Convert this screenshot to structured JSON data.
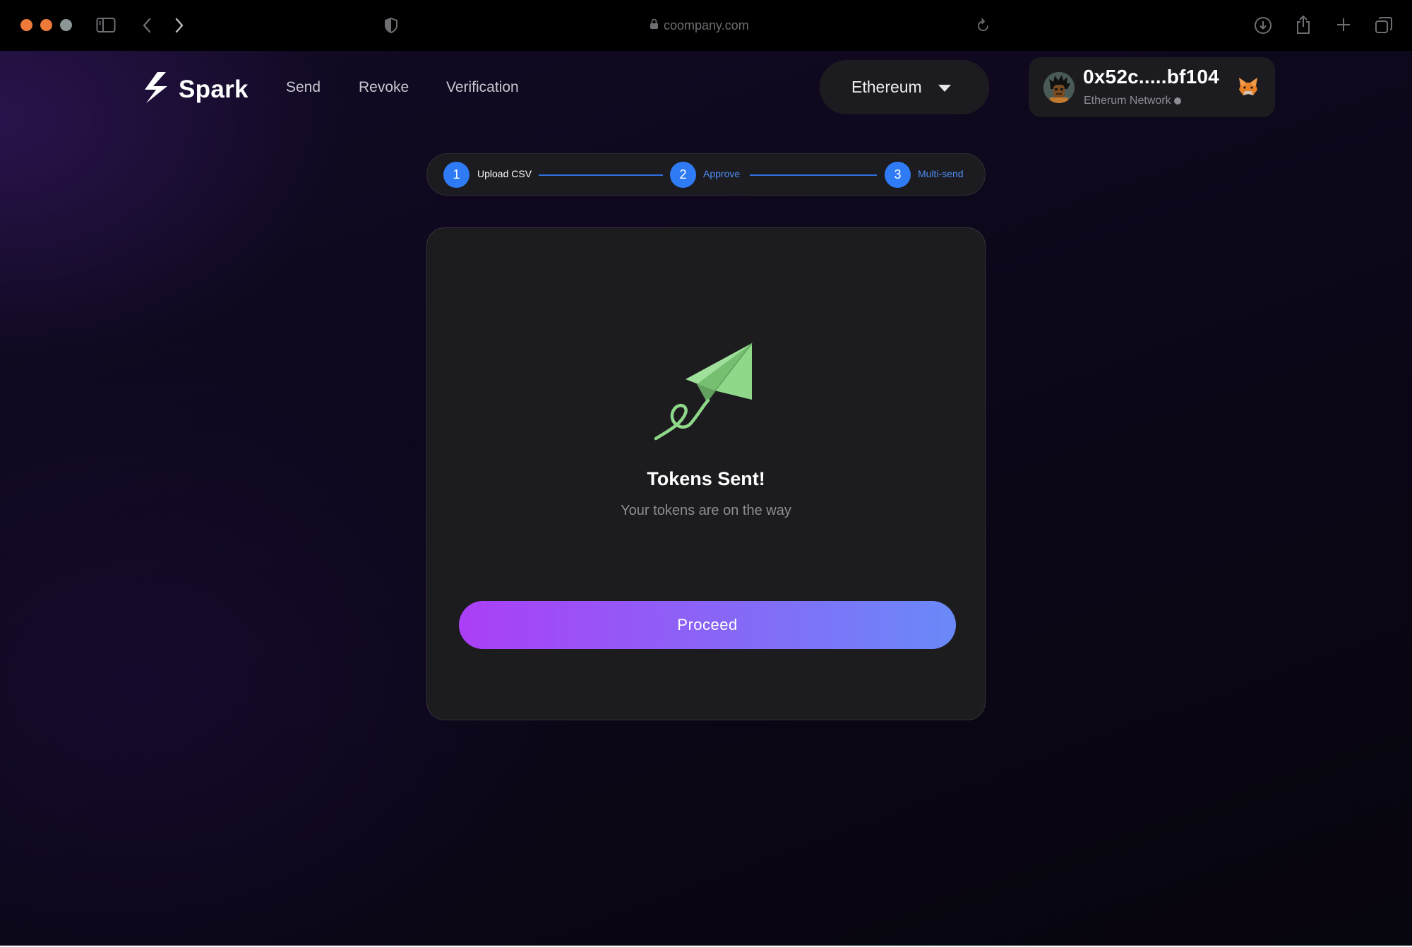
{
  "browser": {
    "url": "coompany.com",
    "traffic_lights": [
      "#ee7a3a",
      "#ee7a3a",
      "#8d9696"
    ],
    "icons": [
      "sidebar-icon",
      "back-icon",
      "forward-icon",
      "shield-icon",
      "lock-icon",
      "reload-icon",
      "download-icon",
      "share-icon",
      "new-tab-icon",
      "tabs-overview-icon"
    ]
  },
  "header": {
    "logo_text": "Spark",
    "nav": [
      "Send",
      "Revoke",
      "Verification"
    ],
    "network_select": {
      "value": "Ethereum",
      "icon": "caret-down-icon"
    },
    "wallet": {
      "address": "0x52c.....bf104",
      "network": "Etherum Network",
      "icons": [
        "avatar",
        "status-dot",
        "metamask-fox-icon"
      ]
    }
  },
  "stepper": {
    "steps": [
      {
        "number": "1",
        "label": "Upload CSV"
      },
      {
        "number": "2",
        "label": "Approve"
      },
      {
        "number": "3",
        "label": "Multi-send"
      }
    ]
  },
  "card": {
    "icon": "paper-plane-icon",
    "title": "Tokens Sent!",
    "subtitle": "Your tokens are on the way",
    "button_label": "Proceed"
  },
  "colors": {
    "accent_blue": "#2f7bf5",
    "button_gradient_start": "#ab3ff6",
    "button_gradient_end": "#6a89f8",
    "plane_green": "#8fd88a"
  }
}
